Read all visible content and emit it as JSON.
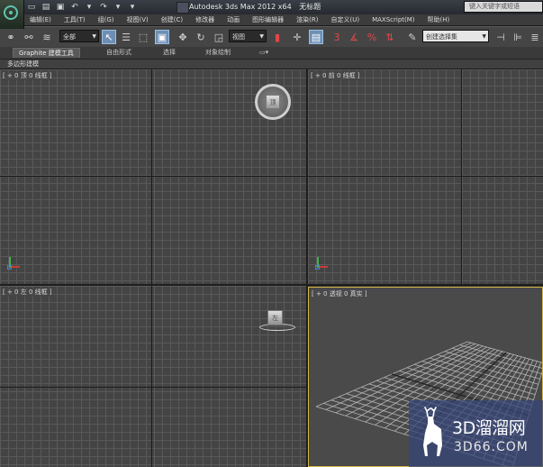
{
  "title": {
    "app_name": "Autodesk 3ds Max  2012 x64",
    "document": "无标题"
  },
  "search": {
    "placeholder": "键入关键字或短语"
  },
  "quick_access": [
    "new-icon",
    "open-icon",
    "save-icon",
    "undo-icon",
    "undo-dropdown-icon",
    "redo-icon",
    "redo-dropdown-icon",
    "more-icon"
  ],
  "menu": [
    "编辑(E)",
    "工具(T)",
    "组(G)",
    "视图(V)",
    "创建(C)",
    "修改器",
    "动画",
    "图形编辑器",
    "渲染(R)",
    "自定义(U)",
    "MAXScript(M)",
    "帮助(H)"
  ],
  "toolbar": {
    "selection_filter": "全部",
    "reference_coord": "视图",
    "named_selection": "创建选择集"
  },
  "ribbon": {
    "tabs": [
      "Graphite 建模工具",
      "自由形式",
      "选择",
      "对象绘制"
    ],
    "panel_label": "多边形建模"
  },
  "viewports": {
    "top": {
      "label": "[ + 0 顶 0 线框 ]",
      "cube_face": "顶"
    },
    "front": {
      "label": "[ + 0 前 0 线框 ]"
    },
    "left": {
      "label": "[ + 0 左 0 线框 ]",
      "cube_face": "左"
    },
    "perspective": {
      "label": "[ + 0 透视 0 真实 ]"
    }
  },
  "watermark": {
    "brand": "3D溜溜网",
    "domain": "3D66.COM"
  },
  "colors": {
    "active_viewport_border": "#d6b84a",
    "grid_line": "#595959",
    "viewport_bg": "#444444",
    "watermark_bg": "#37467a"
  }
}
